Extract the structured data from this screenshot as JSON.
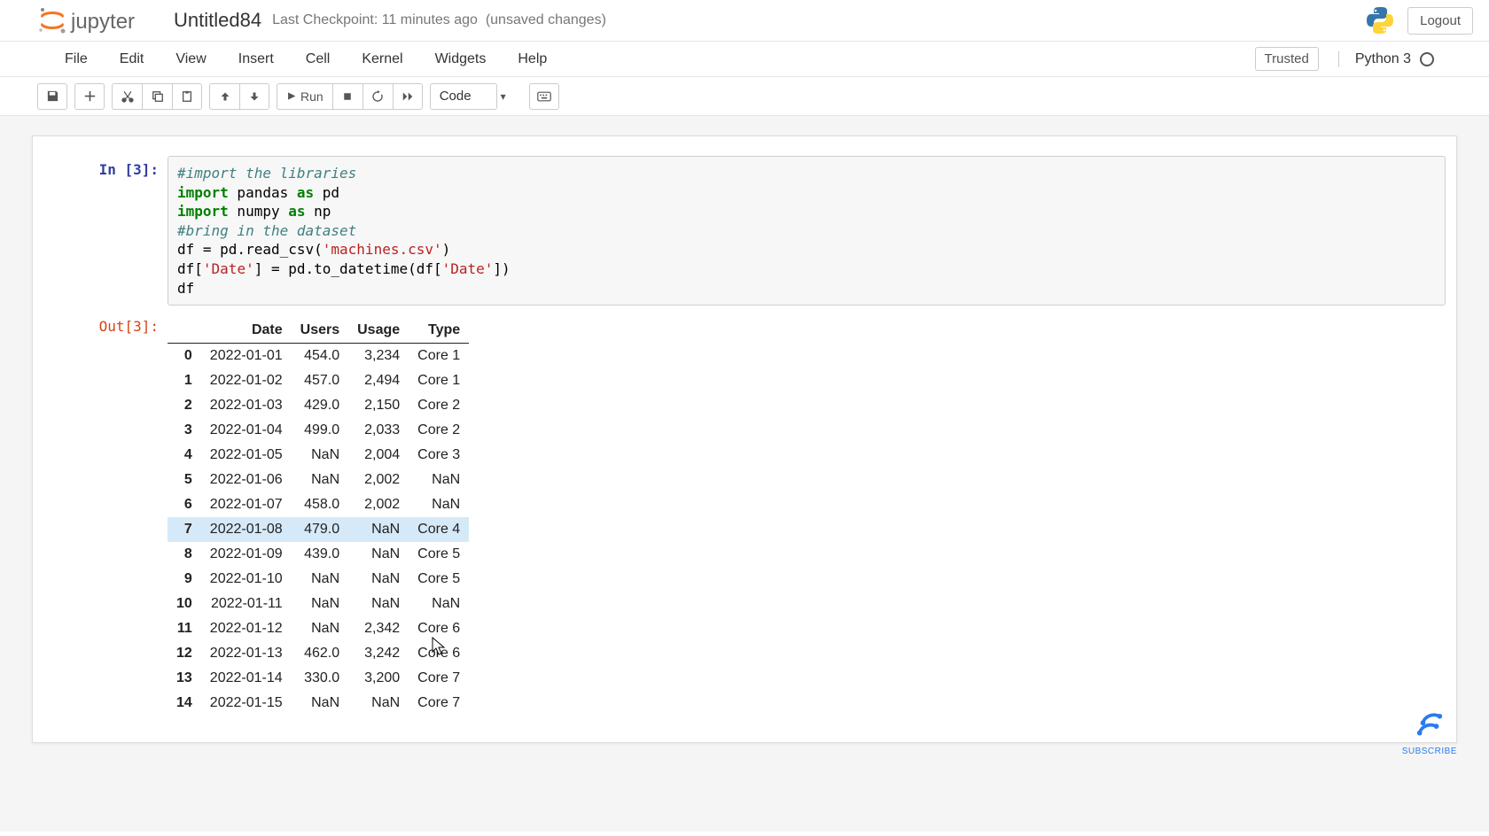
{
  "header": {
    "title": "Untitled84",
    "checkpoint": "Last Checkpoint: 11 minutes ago",
    "unsaved": "(unsaved changes)",
    "logout": "Logout"
  },
  "menubar": {
    "items": [
      "File",
      "Edit",
      "View",
      "Insert",
      "Cell",
      "Kernel",
      "Widgets",
      "Help"
    ],
    "trusted": "Trusted",
    "kernel": "Python 3"
  },
  "toolbar": {
    "run_label": "Run",
    "celltype": "Code"
  },
  "code": {
    "in_prompt": "In [3]:",
    "out_prompt": "Out[3]:",
    "line1_comment": "#import the libraries",
    "line2_kw1": "import",
    "line2_mod": " pandas ",
    "line2_kw2": "as",
    "line2_alias": " pd",
    "line3_kw1": "import",
    "line3_mod": " numpy ",
    "line3_kw2": "as",
    "line3_alias": " np",
    "line4_comment": "#bring in the dataset",
    "line5_a": "df = pd.read_csv(",
    "line5_str": "'machines.csv'",
    "line5_b": ")",
    "line6_a": "df[",
    "line6_str1": "'Date'",
    "line6_b": "] = pd.to_datetime(df[",
    "line6_str2": "'Date'",
    "line6_c": "])",
    "line7": "df"
  },
  "table": {
    "columns": [
      "Date",
      "Users",
      "Usage",
      "Type"
    ],
    "rows": [
      {
        "idx": "0",
        "Date": "2022-01-01",
        "Users": "454.0",
        "Usage": "3,234",
        "Type": "Core 1"
      },
      {
        "idx": "1",
        "Date": "2022-01-02",
        "Users": "457.0",
        "Usage": "2,494",
        "Type": "Core 1"
      },
      {
        "idx": "2",
        "Date": "2022-01-03",
        "Users": "429.0",
        "Usage": "2,150",
        "Type": "Core 2"
      },
      {
        "idx": "3",
        "Date": "2022-01-04",
        "Users": "499.0",
        "Usage": "2,033",
        "Type": "Core 2"
      },
      {
        "idx": "4",
        "Date": "2022-01-05",
        "Users": "NaN",
        "Usage": "2,004",
        "Type": "Core 3"
      },
      {
        "idx": "5",
        "Date": "2022-01-06",
        "Users": "NaN",
        "Usage": "2,002",
        "Type": "NaN"
      },
      {
        "idx": "6",
        "Date": "2022-01-07",
        "Users": "458.0",
        "Usage": "2,002",
        "Type": "NaN"
      },
      {
        "idx": "7",
        "Date": "2022-01-08",
        "Users": "479.0",
        "Usage": "NaN",
        "Type": "Core 4"
      },
      {
        "idx": "8",
        "Date": "2022-01-09",
        "Users": "439.0",
        "Usage": "NaN",
        "Type": "Core 5"
      },
      {
        "idx": "9",
        "Date": "2022-01-10",
        "Users": "NaN",
        "Usage": "NaN",
        "Type": "Core 5"
      },
      {
        "idx": "10",
        "Date": "2022-01-11",
        "Users": "NaN",
        "Usage": "NaN",
        "Type": "NaN"
      },
      {
        "idx": "11",
        "Date": "2022-01-12",
        "Users": "NaN",
        "Usage": "2,342",
        "Type": "Core 6"
      },
      {
        "idx": "12",
        "Date": "2022-01-13",
        "Users": "462.0",
        "Usage": "3,242",
        "Type": "Core 6"
      },
      {
        "idx": "13",
        "Date": "2022-01-14",
        "Users": "330.0",
        "Usage": "3,200",
        "Type": "Core 7"
      },
      {
        "idx": "14",
        "Date": "2022-01-15",
        "Users": "NaN",
        "Usage": "NaN",
        "Type": "Core 7"
      }
    ],
    "hovered_row": 7
  },
  "subscribe_label": "SUBSCRIBE"
}
